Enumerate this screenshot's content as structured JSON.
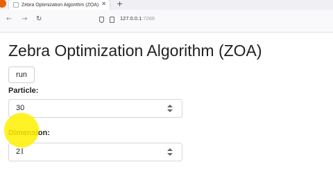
{
  "browser": {
    "tab": {
      "title": "Zebra Optimization Algorithm (ZOA)",
      "close_glyph": "✕"
    },
    "new_tab_glyph": "+",
    "nav": {
      "back_glyph": "←",
      "forward_glyph": "→",
      "reload_glyph": "↻"
    },
    "url": {
      "host": "127.0.0.1",
      "port": ":7266"
    }
  },
  "page": {
    "title": "Zebra Optimization Algorithm (ZOA)",
    "run_button_label": "run",
    "fields": [
      {
        "label": "Particle:",
        "value": "30"
      },
      {
        "label": "Dimension:",
        "value": "2"
      }
    ],
    "cursor_glyph": "I"
  },
  "icons": [
    "browser-logo-icon",
    "favicon-icon",
    "close-icon",
    "plus-icon",
    "back-arrow-icon",
    "forward-arrow-icon",
    "reload-icon",
    "shield-icon",
    "page-icon",
    "spinner-up-icon",
    "spinner-down-icon",
    "text-cursor-icon"
  ],
  "colors": {
    "browser_logo": "#e66000",
    "cursor_highlight": "#fff000",
    "tabstrip_bg": "#f0f0f4"
  }
}
